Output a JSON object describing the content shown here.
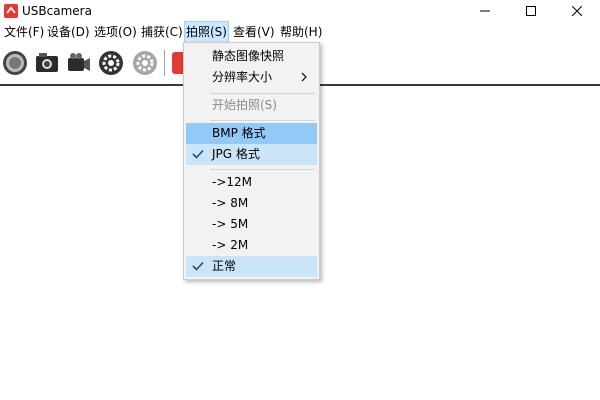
{
  "window": {
    "title": "USBcamera"
  },
  "menubar": {
    "items": [
      {
        "label": "文件(F)"
      },
      {
        "label": "设备(D)"
      },
      {
        "label": "选项(O)"
      },
      {
        "label": "捕获(C)"
      },
      {
        "label": "拍照(S)"
      },
      {
        "label": "查看(V)"
      },
      {
        "label": "帮助(H)"
      }
    ]
  },
  "dropdown": {
    "items": [
      {
        "label": "静态图像快照"
      },
      {
        "label": "分辨率大小"
      },
      {
        "label": "开始拍照(S)"
      },
      {
        "label": "BMP 格式"
      },
      {
        "label": "JPG 格式"
      },
      {
        "label": "->12M"
      },
      {
        "label": "-> 8M"
      },
      {
        "label": "-> 5M"
      },
      {
        "label": "-> 2M"
      },
      {
        "label": "正常"
      }
    ]
  },
  "colors": {
    "brand": "#e53935",
    "highlight": "#91c9f7",
    "checked": "#cce4f7"
  }
}
